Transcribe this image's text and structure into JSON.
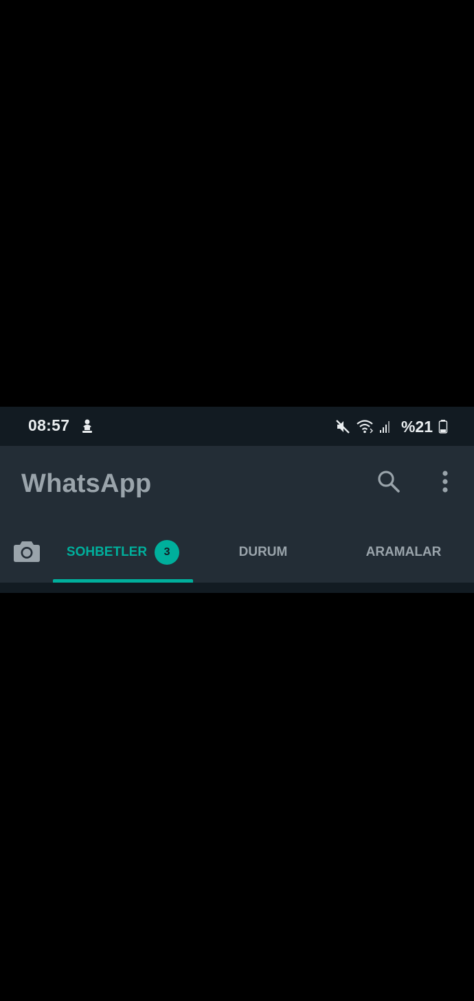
{
  "status_bar": {
    "time": "08:57",
    "battery_text": "%21",
    "icons": [
      "pin-notification-icon",
      "mute-icon",
      "wifi-icon",
      "signal-icon",
      "battery-icon"
    ]
  },
  "app_bar": {
    "title": "WhatsApp",
    "icons": [
      "search-icon",
      "more-vert-icon"
    ]
  },
  "tabs": {
    "camera_icon": "camera-icon",
    "items": [
      {
        "label": "SOHBETLER",
        "badge": "3",
        "selected": true
      },
      {
        "label": "DURUM",
        "selected": false
      },
      {
        "label": "ARAMALAR",
        "selected": false
      }
    ]
  },
  "colors": {
    "status_bar_bg": "#121b22",
    "app_bar_bg": "#232d36",
    "accent": "#00af9c",
    "inactive_text": "#9aa4ab"
  }
}
